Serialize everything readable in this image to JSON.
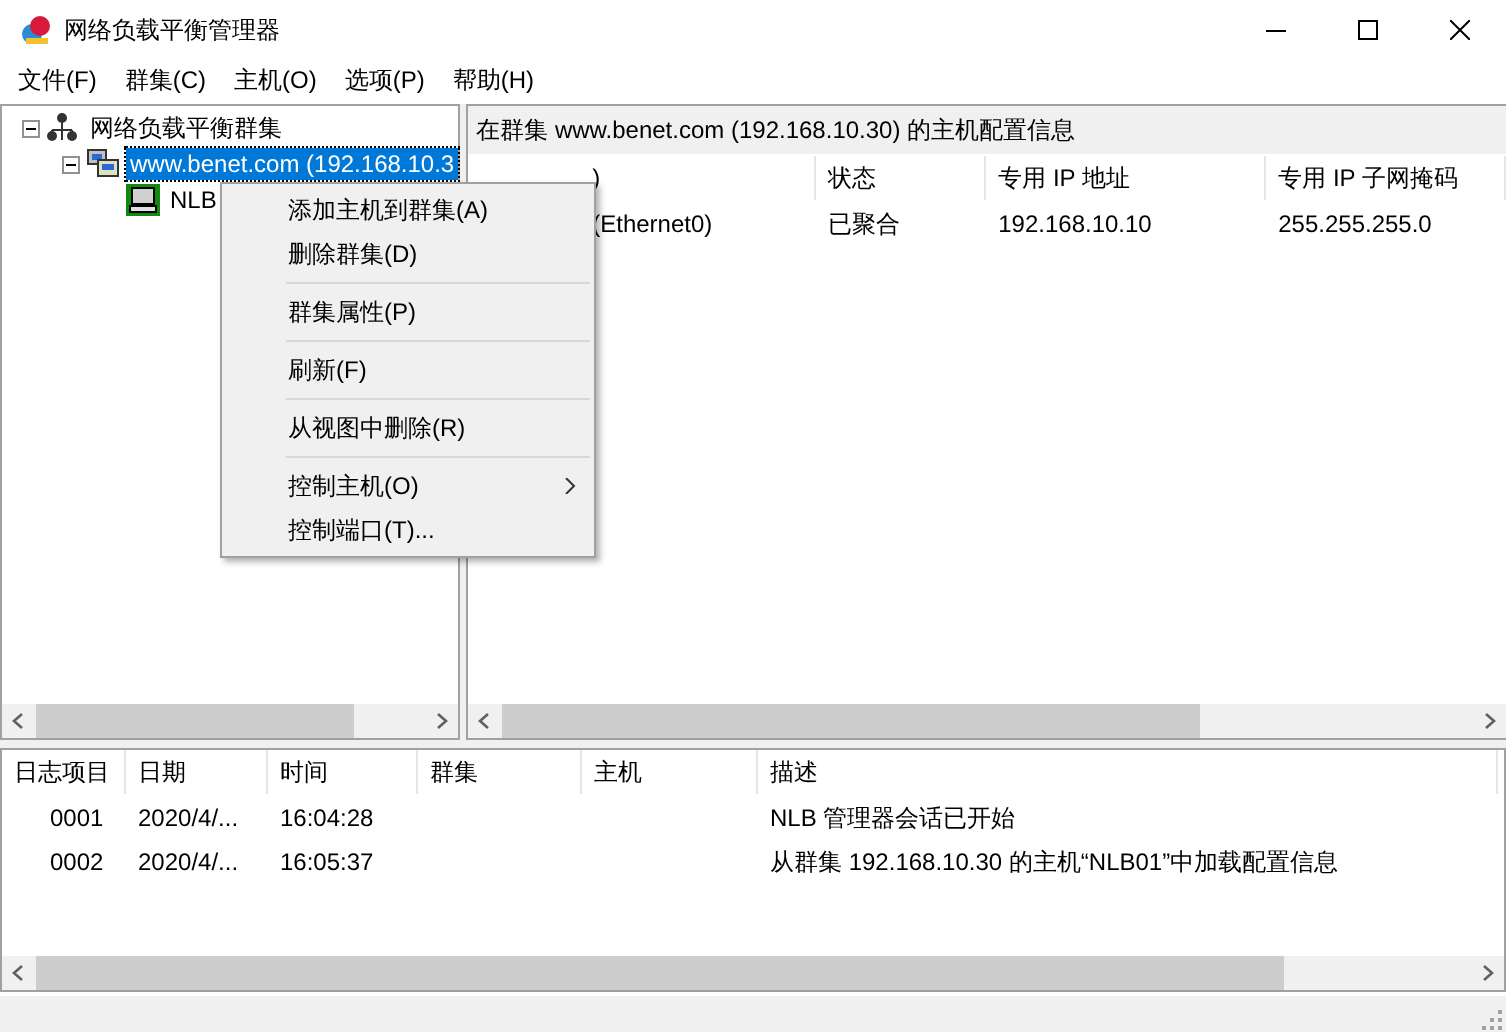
{
  "window": {
    "title": "网络负载平衡管理器"
  },
  "menu_bar": [
    "文件(F)",
    "群集(C)",
    "主机(O)",
    "选项(P)",
    "帮助(H)"
  ],
  "tree": {
    "label": "网络负载平衡群集",
    "expanded": true,
    "children": [
      {
        "label": "www.benet.com (192.168.10.3",
        "selected": true,
        "expanded": true,
        "children": [
          {
            "label": "NLB",
            "selected": false
          }
        ]
      }
    ]
  },
  "detail": {
    "heading": "在群集 www.benet.com (192.168.10.30) 的主机配置信息",
    "columns": [
      ")",
      "状态",
      "专用 IP 地址",
      "专用 IP 子网掩码"
    ],
    "rows": [
      [
        "(Ethernet0)",
        "已聚合",
        "192.168.10.10",
        "255.255.255.0"
      ]
    ]
  },
  "log": {
    "columns": [
      "日志项目",
      "日期",
      "时间",
      "群集",
      "主机",
      "描述"
    ],
    "rows": [
      [
        "0001",
        "2020/4/...",
        "16:04:28",
        "",
        "",
        "NLB 管理器会话已开始"
      ],
      [
        "0002",
        "2020/4/...",
        "16:05:37",
        "",
        "",
        "从群集 192.168.10.30 的主机“NLB01”中加载配置信息"
      ]
    ]
  },
  "context_menu": {
    "items": [
      {
        "kind": "item",
        "label": "添加主机到群集(A)",
        "submenu": false
      },
      {
        "kind": "item",
        "label": "删除群集(D)",
        "submenu": false
      },
      {
        "kind": "separator"
      },
      {
        "kind": "item",
        "label": "群集属性(P)",
        "submenu": false
      },
      {
        "kind": "separator"
      },
      {
        "kind": "item",
        "label": "刷新(F)",
        "submenu": false
      },
      {
        "kind": "separator"
      },
      {
        "kind": "item",
        "label": "从视图中删除(R)",
        "submenu": false
      },
      {
        "kind": "separator"
      },
      {
        "kind": "item",
        "label": "控制主机(O)",
        "submenu": true
      },
      {
        "kind": "item",
        "label": "控制端口(T)...",
        "submenu": false
      }
    ]
  }
}
